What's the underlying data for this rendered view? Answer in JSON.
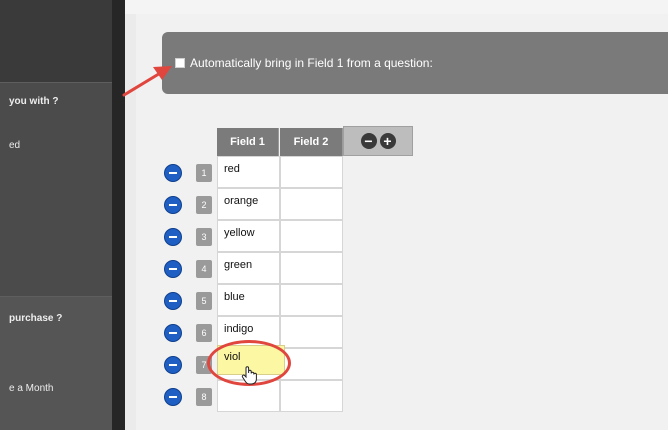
{
  "sidebar": {
    "items": [
      {
        "text": "you with ?",
        "bold": true
      },
      {
        "text": "ed",
        "bold": false
      },
      {
        "text": "purchase ?",
        "bold": true
      },
      {
        "text": "e a Month",
        "bold": false
      }
    ]
  },
  "option": {
    "label": "Automatically bring in Field 1 from a question:"
  },
  "table": {
    "headers": [
      "Field 1",
      "Field 2"
    ],
    "tools": [
      "−",
      "+"
    ],
    "rows": [
      {
        "num": "1",
        "field1": "red",
        "field2": ""
      },
      {
        "num": "2",
        "field1": "orange",
        "field2": ""
      },
      {
        "num": "3",
        "field1": "yellow",
        "field2": ""
      },
      {
        "num": "4",
        "field1": "green",
        "field2": ""
      },
      {
        "num": "5",
        "field1": "blue",
        "field2": ""
      },
      {
        "num": "6",
        "field1": "indigo",
        "field2": ""
      },
      {
        "num": "7",
        "field1": "",
        "field2": ""
      },
      {
        "num": "8",
        "field1": "",
        "field2": ""
      }
    ],
    "editing_value": "viol"
  },
  "colors": {
    "accent_blue": "#1f5fc4",
    "highlight_red": "#e0463e",
    "edit_yellow": "#fcf7a2"
  }
}
